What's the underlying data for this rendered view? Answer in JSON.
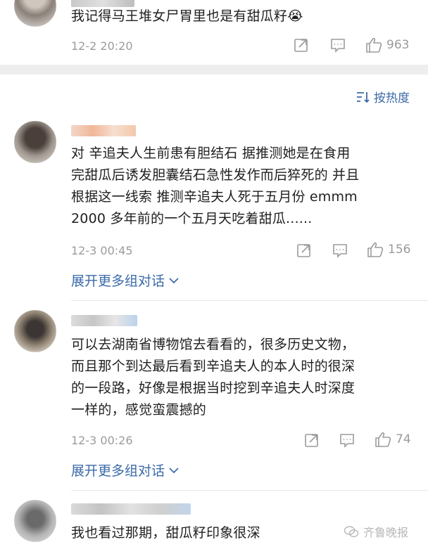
{
  "comments": [
    {
      "text_lines": [
        "我记得马王堆女尸胃里也是有甜瓜籽😭"
      ],
      "time": "12-2 20:20",
      "likes": "963"
    },
    {
      "text_lines": [
        "对 辛追夫人生前患有胆结石  据推测她是在食用",
        "完甜瓜后诱发胆囊结石急性发作而后猝死的 并且",
        "根据这一线索 推测辛追夫人死于五月份 emmm",
        "2000 多年前的一个五月天吃着甜瓜......"
      ],
      "time": "12-3 00:45",
      "likes": "156",
      "expand": "展开更多组对话"
    },
    {
      "text_lines": [
        "可以去湖南省博物馆去看看的，很多历史文物，",
        "而且那个到达最后看到辛追夫人的本人时的很深",
        "的一段路，好像是根据当时挖到辛追夫人时深度",
        "一样的，感觉蛮震撼的"
      ],
      "time": "12-3 00:26",
      "likes": "74",
      "expand": "展开更多组对话"
    },
    {
      "text_lines": [
        "我也看过那期，甜瓜籽印象很深"
      ]
    }
  ],
  "sort_label": "按热度",
  "watermark": "齐鲁晚报",
  "colors": {
    "link": "#3b6aa8",
    "meta": "#9b9b9b",
    "separator": "#eeeeee"
  },
  "icons": [
    "share-icon",
    "comment-icon",
    "like-icon",
    "sort-icon",
    "chevron-down-icon",
    "wechat-icon"
  ]
}
